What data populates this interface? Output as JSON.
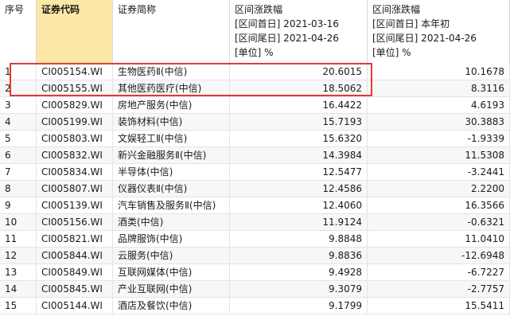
{
  "header": {
    "col_index": "序号",
    "col_code": "证券代码",
    "col_name": "证券简称",
    "col_range1": {
      "title": "区间涨跌幅",
      "start": "[区间首日] 2021-03-16",
      "end": "[区间尾日] 2021-04-26",
      "unit": "[单位] %"
    },
    "col_range2": {
      "title": "区间涨跌幅",
      "start": "[区间首日] 本年初",
      "end": "[区间尾日] 2021-04-26",
      "unit": "[单位] %"
    }
  },
  "rows": [
    {
      "idx": "1",
      "code": "CI005154.WI",
      "name": "生物医药Ⅱ(中信)",
      "v1": "20.6015",
      "v2": "10.1678"
    },
    {
      "idx": "2",
      "code": "CI005155.WI",
      "name": "其他医药医疗(中信)",
      "v1": "18.5062",
      "v2": "8.3116"
    },
    {
      "idx": "3",
      "code": "CI005829.WI",
      "name": "房地产服务(中信)",
      "v1": "16.4422",
      "v2": "4.6193"
    },
    {
      "idx": "4",
      "code": "CI005199.WI",
      "name": "装饰材料(中信)",
      "v1": "15.7193",
      "v2": "30.3883"
    },
    {
      "idx": "5",
      "code": "CI005803.WI",
      "name": "文娱轻工Ⅱ(中信)",
      "v1": "15.6320",
      "v2": "-1.9339"
    },
    {
      "idx": "6",
      "code": "CI005832.WI",
      "name": "新兴金融服务Ⅱ(中信)",
      "v1": "14.3984",
      "v2": "11.5308"
    },
    {
      "idx": "7",
      "code": "CI005834.WI",
      "name": "半导体(中信)",
      "v1": "12.5477",
      "v2": "-3.2441"
    },
    {
      "idx": "8",
      "code": "CI005807.WI",
      "name": "仪器仪表Ⅱ(中信)",
      "v1": "12.4586",
      "v2": "2.2200"
    },
    {
      "idx": "9",
      "code": "CI005139.WI",
      "name": "汽车销售及服务Ⅱ(中信)",
      "v1": "12.4060",
      "v2": "16.3566"
    },
    {
      "idx": "10",
      "code": "CI005156.WI",
      "name": "酒类(中信)",
      "v1": "11.9124",
      "v2": "-0.6321"
    },
    {
      "idx": "11",
      "code": "CI005821.WI",
      "name": "品牌服饰(中信)",
      "v1": "9.8848",
      "v2": "11.0410"
    },
    {
      "idx": "12",
      "code": "CI005844.WI",
      "name": "云服务(中信)",
      "v1": "9.8836",
      "v2": "-12.6948"
    },
    {
      "idx": "13",
      "code": "CI005849.WI",
      "name": "互联网媒体(中信)",
      "v1": "9.4928",
      "v2": "-6.7227"
    },
    {
      "idx": "14",
      "code": "CI005845.WI",
      "name": "产业互联网(中信)",
      "v1": "9.3079",
      "v2": "-2.7757"
    },
    {
      "idx": "15",
      "code": "CI005144.WI",
      "name": "酒店及餐饮(中信)",
      "v1": "9.1799",
      "v2": "15.5411"
    }
  ],
  "highlight_color": "#e53935",
  "code_header_bg": "#fde7a7"
}
